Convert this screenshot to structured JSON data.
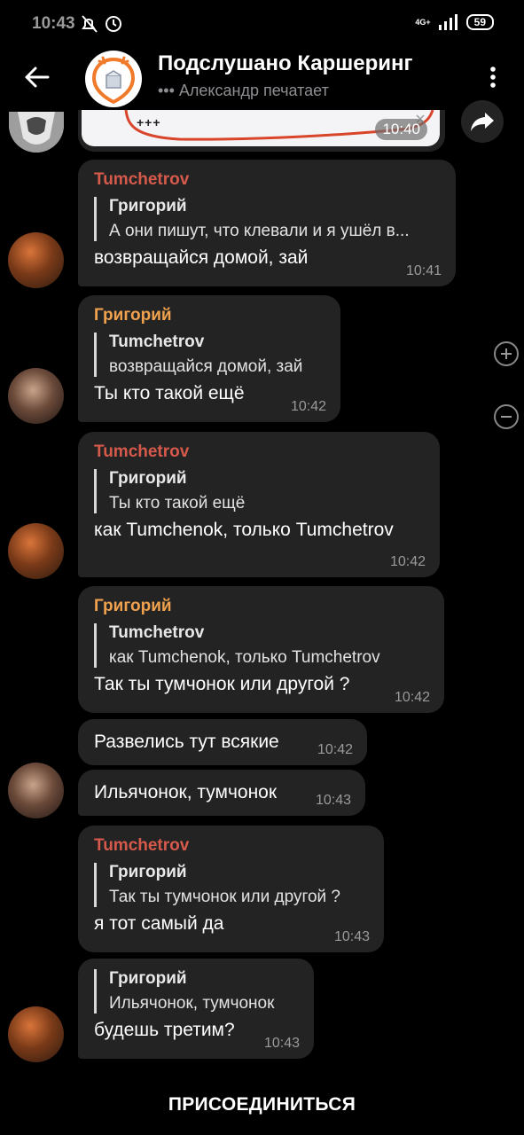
{
  "status_bar": {
    "time": "10:43",
    "network": "4G+",
    "battery": "59"
  },
  "header": {
    "title": "Подслушано Каршеринг",
    "subtitle": "••• Александр печатает"
  },
  "partial_message": {
    "content": "+++",
    "time": "10:40"
  },
  "messages": [
    {
      "sender": "Tumchetrov",
      "reply_to": {
        "name": "Григорий",
        "text": "А они пишут, что клевали и я ушёл в..."
      },
      "text": "возвращайся домой, зай",
      "time": "10:41"
    },
    {
      "sender": "Григорий",
      "reply_to": {
        "name": "Tumchetrov",
        "text": "возвращайся домой, зай"
      },
      "text": "Ты кто такой ещё",
      "time": "10:42"
    },
    {
      "sender": "Tumchetrov",
      "reply_to": {
        "name": "Григорий",
        "text": "Ты кто такой ещё"
      },
      "text": "как Tumchenok, только Tumchetrov",
      "time": "10:42"
    },
    {
      "sender": "Григорий",
      "reply_to": {
        "name": "Tumchetrov",
        "text": "как Tumchenok, только Tumchetrov"
      },
      "text": "Так ты тумчонок или другой ?",
      "time": "10:42"
    },
    {
      "text": "Развелись тут всякие",
      "time": "10:42"
    },
    {
      "text": "Ильячонок, тумчонок",
      "time": "10:43"
    },
    {
      "sender": "Tumchetrov",
      "reply_to": {
        "name": "Григорий",
        "text": "Так ты тумчонок или другой ?"
      },
      "text": "я тот самый да",
      "time": "10:43"
    },
    {
      "reply_to": {
        "name": "Григорий",
        "text": "Ильячонок, тумчонок"
      },
      "text": "будешь третим?",
      "time": "10:43"
    }
  ],
  "footer": {
    "join_label": "ПРИСОЕДИНИТЬСЯ"
  },
  "colors": {
    "background": "#000000",
    "bubble": "#232323",
    "tumchetrov": "#d65a4b",
    "grigoriy": "#f0a14e"
  },
  "icons": [
    "back-arrow-icon",
    "more-vert-icon",
    "share-icon",
    "zoom-in-icon",
    "zoom-out-icon"
  ]
}
